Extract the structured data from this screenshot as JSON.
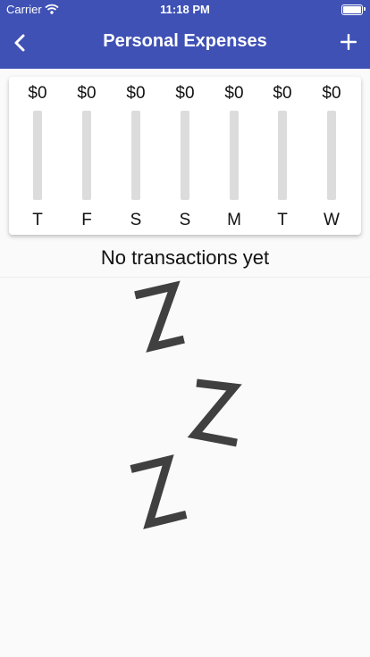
{
  "status_bar": {
    "carrier": "Carrier",
    "time": "11:18 PM"
  },
  "nav": {
    "title": "Personal Expenses"
  },
  "chart_data": {
    "type": "bar",
    "categories": [
      "T",
      "F",
      "S",
      "S",
      "M",
      "T",
      "W"
    ],
    "value_labels": [
      "$0",
      "$0",
      "$0",
      "$0",
      "$0",
      "$0",
      "$0"
    ],
    "values": [
      0,
      0,
      0,
      0,
      0,
      0,
      0
    ]
  },
  "empty_state": {
    "message": "No transactions yet",
    "icon": "sleeping-zzz-icon"
  },
  "colors": {
    "primary": "#3f51b5",
    "bar_track": "#dcdcdc",
    "illustration": "#404040"
  }
}
